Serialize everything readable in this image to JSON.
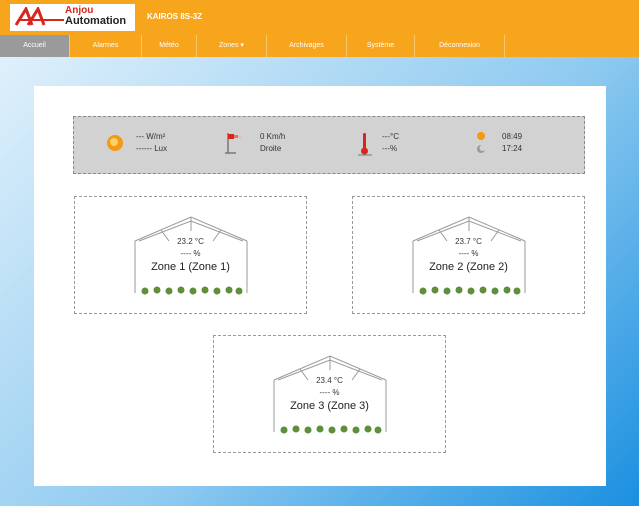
{
  "header": {
    "logo_line1": "Anjou",
    "logo_line2": "Automation",
    "app_title": "KAIROS 8S-3Z",
    "brand_color": "#f7a51c"
  },
  "nav": {
    "items": [
      {
        "label": "Accueil",
        "active": true
      },
      {
        "label": "Alarmes"
      },
      {
        "label": "Météo"
      },
      {
        "label": "Zones ▾"
      },
      {
        "label": "Archivages"
      },
      {
        "label": "Système"
      },
      {
        "label": "Déconnexion"
      }
    ]
  },
  "weather": {
    "radiation": "--- W/m²",
    "lux": "------ Lux",
    "wind_speed": "0 Km/h",
    "wind_direction": "Droite",
    "temperature": "---°C",
    "humidity": "---%",
    "sunrise": "08:49",
    "sunset": "17:24"
  },
  "zones": [
    {
      "temp": "23.2 °C",
      "humidity": "---- %",
      "name": "Zone 1 (Zone 1)"
    },
    {
      "temp": "23.7 °C",
      "humidity": "---- %",
      "name": "Zone 2 (Zone 2)"
    },
    {
      "temp": "23.4 °C",
      "humidity": "---- %",
      "name": "Zone 3 (Zone 3)"
    }
  ]
}
